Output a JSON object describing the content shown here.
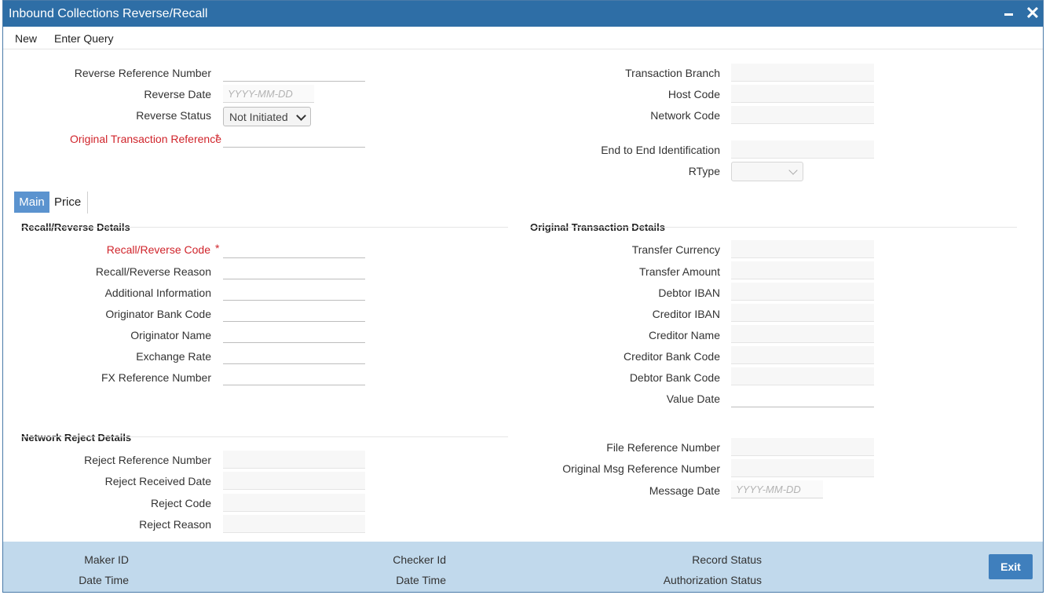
{
  "window": {
    "title": "Inbound Collections Reverse/Recall"
  },
  "menu": {
    "new": "New",
    "enter_query": "Enter Query"
  },
  "header_left": {
    "reverse_reference_number": "Reverse Reference Number",
    "reverse_date": "Reverse Date",
    "reverse_date_placeholder": "YYYY-MM-DD",
    "reverse_status": "Reverse Status",
    "reverse_status_value": "Not Initiated",
    "original_transaction_reference": "Original Transaction Reference"
  },
  "header_right": {
    "transaction_branch": "Transaction Branch",
    "host_code": "Host Code",
    "network_code": "Network Code",
    "end_to_end_identification": "End to End Identification",
    "rtype": "RType"
  },
  "tabs": {
    "main": "Main",
    "price": "Price"
  },
  "recall_section": {
    "title": "Recall/Reverse Details",
    "recall_reverse_code": "Recall/Reverse Code",
    "recall_reverse_reason": "Recall/Reverse Reason",
    "additional_information": "Additional Information",
    "originator_bank_code": "Originator Bank Code",
    "originator_name": "Originator Name",
    "exchange_rate": "Exchange Rate",
    "fx_reference_number": "FX Reference Number"
  },
  "original_section": {
    "title": "Original Transaction Details",
    "transfer_currency": "Transfer Currency",
    "transfer_amount": "Transfer Amount",
    "debtor_iban": "Debtor IBAN",
    "creditor_iban": "Creditor IBAN",
    "creditor_name": "Creditor Name",
    "creditor_bank_code": "Creditor Bank Code",
    "debtor_bank_code": "Debtor Bank Code",
    "value_date": "Value Date"
  },
  "network_reject_section": {
    "title": "Network Reject Details",
    "reject_reference_number": "Reject Reference Number",
    "reject_received_date": "Reject Received Date",
    "reject_code": "Reject Code",
    "reject_reason": "Reject Reason"
  },
  "file_section": {
    "file_reference_number": "File Reference Number",
    "original_msg_reference_number": "Original Msg Reference Number",
    "message_date": "Message Date",
    "message_date_placeholder": "YYYY-MM-DD"
  },
  "footer": {
    "maker_id": "Maker ID",
    "maker_date_time": "Date Time",
    "checker_id": "Checker Id",
    "checker_date_time": "Date Time",
    "record_status": "Record Status",
    "authorization_status": "Authorization Status",
    "exit": "Exit"
  },
  "colors": {
    "title_bar": "#2e6ea6",
    "active_tab": "#5b93cf",
    "footer_bg": "#c1d9ec",
    "exit_button": "#3f7fbd",
    "required_label": "#d0242b"
  },
  "icons": {
    "minimize": "minimize-icon",
    "close": "close-icon",
    "select_chevron": "chevron-down-icon"
  }
}
